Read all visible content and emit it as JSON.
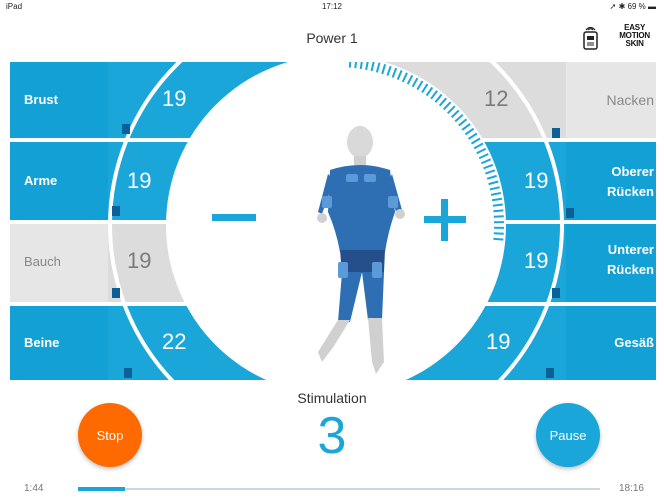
{
  "status": {
    "carrier": "iPad",
    "time": "17:12",
    "battery": "69 %"
  },
  "header": {
    "title": "Power 1",
    "logo_lines": [
      "EASY",
      "MOTION",
      "SKIN"
    ]
  },
  "colors": {
    "accent": "#1aa6d9",
    "inactive": "#dcdcdc",
    "stop": "#ff6a00"
  },
  "muscles": {
    "left": [
      {
        "label": "Brust",
        "value": "19",
        "active": true
      },
      {
        "label": "Arme",
        "value": "19",
        "active": true
      },
      {
        "label": "Bauch",
        "value": "19",
        "active": false
      },
      {
        "label": "Beine",
        "value": "22",
        "active": true
      }
    ],
    "right": [
      {
        "label": "Nacken",
        "value": "12",
        "active": false
      },
      {
        "label": "Oberer Rücken",
        "label_lines": [
          "Oberer",
          "Rücken"
        ],
        "value": "19",
        "active": true
      },
      {
        "label": "Unterer Rücken",
        "label_lines": [
          "Unterer",
          "Rücken"
        ],
        "value": "19",
        "active": true
      },
      {
        "label": "Gesäß",
        "value": "19",
        "active": true
      }
    ]
  },
  "controls": {
    "minus": "−",
    "plus": "+"
  },
  "stimulation": {
    "label": "Stimulation",
    "value": "3"
  },
  "buttons": {
    "stop": "Stop",
    "pause": "Pause"
  },
  "timer": {
    "elapsed": "1:44",
    "total": "18:16",
    "progress": 0.09
  }
}
